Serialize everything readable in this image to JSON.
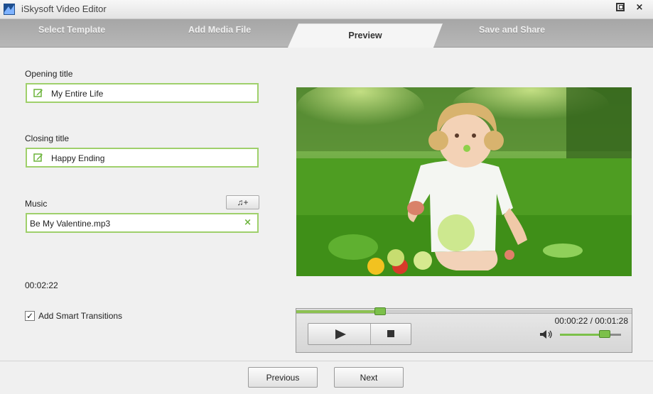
{
  "window": {
    "title": "iSkysoft Video Editor",
    "maximize_icon": "maximize-icon",
    "close_label": "×"
  },
  "tabs": [
    {
      "label": "Select Template",
      "active": false
    },
    {
      "label": "Add Media File",
      "active": false
    },
    {
      "label": "Preview",
      "active": true
    },
    {
      "label": "Save and Share",
      "active": false
    }
  ],
  "form": {
    "opening_title_label": "Opening title",
    "opening_title_value": "My Entire Life",
    "closing_title_label": "Closing title",
    "closing_title_value": "Happy Ending",
    "music_label": "Music",
    "music_value": "Be My Valentine.mp3",
    "add_music_label": "♫+",
    "clear_music_label": "×",
    "duration": "00:02:22",
    "smart_transitions_label": "Add Smart Transitions",
    "smart_transitions_checked": true,
    "check_mark": "✓"
  },
  "player": {
    "time_readout": "00:00:22 / 00:01:28",
    "progress": 0.25,
    "volume": 0.73,
    "accent_color": "#7cc04a"
  },
  "footer": {
    "previous_label": "Previous",
    "next_label": "Next"
  },
  "colors": {
    "field_border": "#9fd06b",
    "tab_bar": "#b0b0b0"
  }
}
